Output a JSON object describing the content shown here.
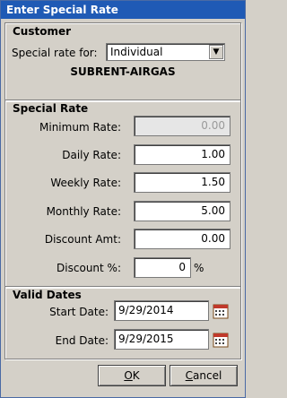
{
  "window": {
    "title": "Enter Special Rate"
  },
  "customer": {
    "group_title": "Customer",
    "special_rate_label": "Special rate for:",
    "special_rate_value": "Individual",
    "customer_name": "SUBRENT-AIRGAS"
  },
  "special_rate": {
    "group_title": "Special Rate",
    "rows": [
      {
        "label": "Minimum Rate:",
        "value": "0.00",
        "disabled": true
      },
      {
        "label": "Daily Rate:",
        "value": "1.00"
      },
      {
        "label": "Weekly Rate:",
        "value": "1.50"
      },
      {
        "label": "Monthly Rate:",
        "value": "5.00"
      },
      {
        "label": "Discount Amt:",
        "value": "0.00"
      },
      {
        "label": "Discount %:",
        "value": "0",
        "suffix": "%"
      }
    ]
  },
  "valid_dates": {
    "group_title": "Valid Dates",
    "start_label": "Start Date:",
    "start_value": "9/29/2014",
    "end_label": "End Date:",
    "end_value": "9/29/2015"
  },
  "buttons": {
    "ok_mnemonic": "O",
    "ok_rest": "K",
    "cancel_mnemonic": "C",
    "cancel_rest": "ancel"
  },
  "icons": {
    "start_calendar": "calendar-icon",
    "end_calendar": "calendar-icon",
    "dropdown": "chevron-down-icon"
  }
}
